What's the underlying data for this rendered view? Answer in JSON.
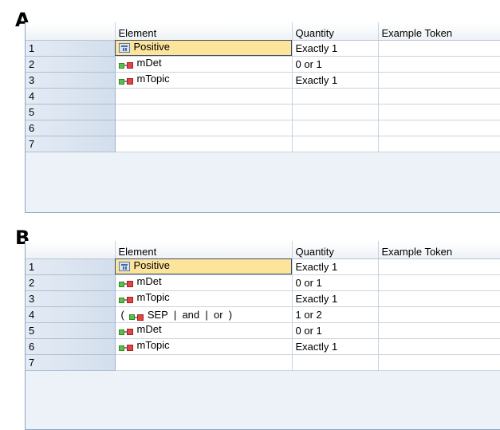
{
  "panels": [
    {
      "label": "A",
      "columns": [
        "Element",
        "Quantity",
        "Example Token"
      ],
      "rows": [
        {
          "num": "1",
          "icon": "concept-icon",
          "prefix": "",
          "text": "Positive",
          "quantity": "Exactly 1",
          "token": "",
          "selected": true
        },
        {
          "num": "2",
          "icon": "macro-icon",
          "prefix": "",
          "text": "mDet",
          "quantity": "0 or 1",
          "token": ""
        },
        {
          "num": "3",
          "icon": "macro-icon",
          "prefix": "",
          "text": "mTopic",
          "quantity": "Exactly 1",
          "token": ""
        },
        {
          "num": "4",
          "icon": "",
          "prefix": "",
          "text": "",
          "quantity": "",
          "token": ""
        },
        {
          "num": "5",
          "icon": "",
          "prefix": "",
          "text": "",
          "quantity": "",
          "token": ""
        },
        {
          "num": "6",
          "icon": "",
          "prefix": "",
          "text": "",
          "quantity": "",
          "token": ""
        },
        {
          "num": "7",
          "icon": "",
          "prefix": "",
          "text": "",
          "quantity": "",
          "token": ""
        }
      ]
    },
    {
      "label": "B",
      "columns": [
        "Element",
        "Quantity",
        "Example Token"
      ],
      "rows": [
        {
          "num": "1",
          "icon": "concept-icon",
          "prefix": "",
          "text": "Positive",
          "quantity": "Exactly 1",
          "token": "",
          "selected": true
        },
        {
          "num": "2",
          "icon": "macro-icon",
          "prefix": "",
          "text": "mDet",
          "quantity": "0 or 1",
          "token": ""
        },
        {
          "num": "3",
          "icon": "macro-icon",
          "prefix": "",
          "text": "mTopic",
          "quantity": "Exactly 1",
          "token": ""
        },
        {
          "num": "4",
          "icon": "macro-icon",
          "prefix": "(",
          "text": "SEP  |  and  |  or  )",
          "quantity": "1 or 2",
          "token": ""
        },
        {
          "num": "5",
          "icon": "macro-icon",
          "prefix": "",
          "text": "mDet",
          "quantity": "0 or 1",
          "token": ""
        },
        {
          "num": "6",
          "icon": "macro-icon",
          "prefix": "",
          "text": "mTopic",
          "quantity": "Exactly 1",
          "token": ""
        },
        {
          "num": "7",
          "icon": "",
          "prefix": "",
          "text": "",
          "quantity": "",
          "token": ""
        }
      ]
    }
  ]
}
